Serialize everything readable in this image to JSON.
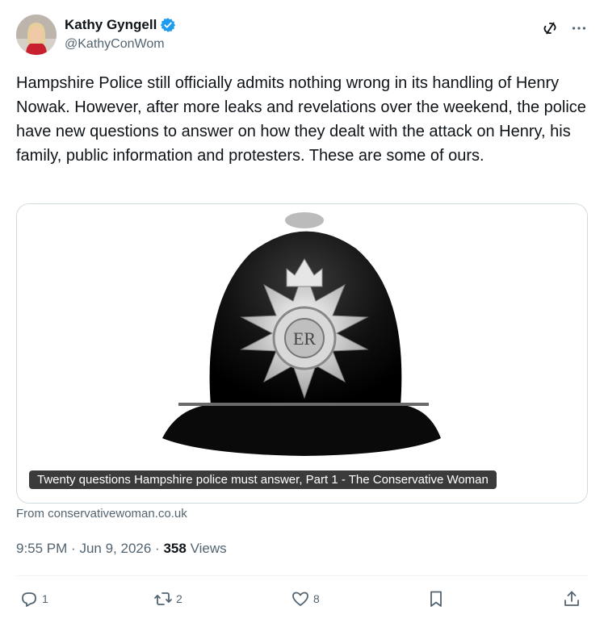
{
  "author": {
    "display_name": "Kathy Gyngell",
    "handle": "@KathyConWom",
    "verified": true
  },
  "icons": {
    "verified": "verified-badge-icon",
    "grok": "grok-icon",
    "more": "more-icon",
    "reply": "reply-icon",
    "retweet": "retweet-icon",
    "like": "like-icon",
    "bookmark": "bookmark-icon",
    "share": "share-icon"
  },
  "tweet": {
    "text": "Hampshire Police still officially admits nothing wrong in its handling of Henry Nowak. However, after more leaks and revelations over the weekend, the police have new questions to answer on how they dealt with the attack on Henry, his family, public information and protesters. These are some of ours."
  },
  "card": {
    "caption": "Twenty questions Hampshire police must answer, Part 1 - The Conservative Woman",
    "source": "From conservativewoman.co.uk"
  },
  "meta": {
    "time": "9:55 PM",
    "separator1": "·",
    "date": "Jun 9, 2026",
    "separator2": "·",
    "views_count": "358",
    "views_label": "Views"
  },
  "actions": {
    "replies": "1",
    "retweets": "2",
    "likes": "8"
  },
  "colors": {
    "text_primary": "#0f1419",
    "text_secondary": "#536471",
    "verified_blue": "#1d9bf0",
    "border": "#cfd9de"
  }
}
